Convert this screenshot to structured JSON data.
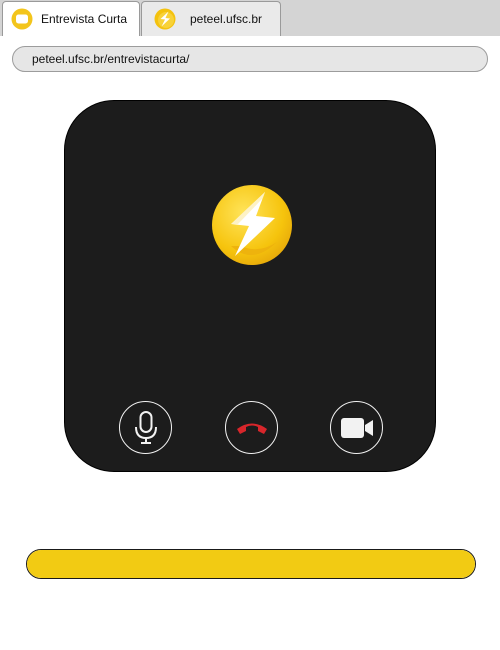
{
  "tabs": [
    {
      "label": "Entrevista Curta",
      "active": true,
      "icon": "folder-icon"
    },
    {
      "label": "peteel.ufsc.br",
      "active": false,
      "icon": "lightning-logo-icon"
    }
  ],
  "address_bar": {
    "url": "peteel.ufsc.br/entrevistacurta/"
  },
  "call": {
    "logo_icon": "lightning-logo-icon",
    "controls": [
      {
        "name": "microphone",
        "icon": "microphone-icon"
      },
      {
        "name": "hang-up",
        "icon": "phone-hangup-icon",
        "color": "#d8262b"
      },
      {
        "name": "camera",
        "icon": "video-camera-icon"
      }
    ]
  },
  "progress": {
    "value": 1.0,
    "color": "#f2cb13"
  },
  "colors": {
    "panel": "#1c1c1c",
    "accent_yellow": "#f2cb13",
    "tabbar": "#d4d4d4"
  }
}
